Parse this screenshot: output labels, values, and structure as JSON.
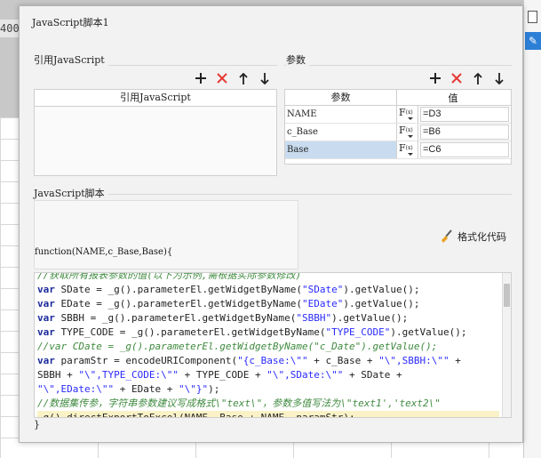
{
  "background": {
    "ruler_text": "400"
  },
  "dialog": {
    "title": "JavaScript脚本1"
  },
  "ref_section": {
    "label": "引用JavaScript",
    "column_header": "引用JavaScript",
    "items": []
  },
  "params_section": {
    "label": "参数",
    "headers": {
      "name": "参数",
      "value": "值"
    },
    "rows": [
      {
        "name": "NAME",
        "fx": "F",
        "fx_sub": "(x)",
        "value": "=D3",
        "selected": false
      },
      {
        "name": "c_Base",
        "fx": "F",
        "fx_sub": "(x)",
        "value": "=B6",
        "selected": false
      },
      {
        "name": "Base",
        "fx": "F",
        "fx_sub": "(x)",
        "value": "=C6",
        "selected": true
      }
    ]
  },
  "toolbar_icons": [
    "plus-icon",
    "delete-icon",
    "arrow-up-icon",
    "arrow-down-icon"
  ],
  "colors": {
    "delete": "#e53935",
    "selection": "#c9dcef",
    "keyword": "#1a2a9c",
    "string": "#2a2aff",
    "comment": "#3f8a3f",
    "highlight": "#faf2c6"
  },
  "script_section": {
    "label": "JavaScript脚本",
    "function_signature": "function(NAME,c_Base,Base){",
    "format_button": "格式化代码",
    "closing_brace": "}",
    "code_lines": [
      [
        {
          "t": "cm",
          "v": "//获取所有报表参数的值(以下为示例,需根据实际参数修改)"
        }
      ],
      [
        {
          "t": "kw",
          "v": "var"
        },
        {
          "t": "p",
          "v": " SDate = _g().parameterEl.getWidgetByName("
        },
        {
          "t": "str",
          "v": "\"SDate\""
        },
        {
          "t": "p",
          "v": ").getValue();"
        }
      ],
      [
        {
          "t": "kw",
          "v": "var"
        },
        {
          "t": "p",
          "v": " EDate = _g().parameterEl.getWidgetByName("
        },
        {
          "t": "str",
          "v": "\"EDate\""
        },
        {
          "t": "p",
          "v": ").getValue();"
        }
      ],
      [
        {
          "t": "kw",
          "v": "var"
        },
        {
          "t": "p",
          "v": " SBBH = _g().parameterEl.getWidgetByName("
        },
        {
          "t": "str",
          "v": "\"SBBH\""
        },
        {
          "t": "p",
          "v": ").getValue();"
        }
      ],
      [
        {
          "t": "kw",
          "v": "var"
        },
        {
          "t": "p",
          "v": " TYPE_CODE = _g().parameterEl.getWidgetByName("
        },
        {
          "t": "str",
          "v": "\"TYPE_CODE\""
        },
        {
          "t": "p",
          "v": ").getValue();"
        }
      ],
      [
        {
          "t": "cm",
          "v": "//var CDate = _g().parameterEl.getWidgetByName(\"c_Date\").getValue();"
        }
      ],
      [
        {
          "t": "kw",
          "v": "var"
        },
        {
          "t": "p",
          "v": " paramStr = encodeURIComponent("
        },
        {
          "t": "str",
          "v": "\"{c_Base:\\\"\""
        },
        {
          "t": "p",
          "v": " + c_Base + "
        },
        {
          "t": "str",
          "v": "\"\\\",SBBH:\\\"\""
        },
        {
          "t": "p",
          "v": " +"
        }
      ],
      [
        {
          "t": "p",
          "v": "SBBH + "
        },
        {
          "t": "str",
          "v": "\"\\\",TYPE_CODE:\\\"\""
        },
        {
          "t": "p",
          "v": " + TYPE_CODE + "
        },
        {
          "t": "str",
          "v": "\"\\\",SDate:\\\"\""
        },
        {
          "t": "p",
          "v": " + SDate +"
        }
      ],
      [
        {
          "t": "str",
          "v": "\"\\\",EDate:\\\"\""
        },
        {
          "t": "p",
          "v": " + EDate + "
        },
        {
          "t": "str",
          "v": "\"\\\"}\""
        },
        {
          "t": "p",
          "v": ");"
        }
      ],
      [
        {
          "t": "cm",
          "v": "//数据集传参，字符串参数建议写成格式\\\"text\\\"，参数多值写法为\\\"text1','text2\\\""
        }
      ],
      [
        {
          "t": "p",
          "v": "_g().directExportToExcel(NAME, Base + NAME, paramStr);"
        }
      ]
    ],
    "highlighted_line": 10
  }
}
